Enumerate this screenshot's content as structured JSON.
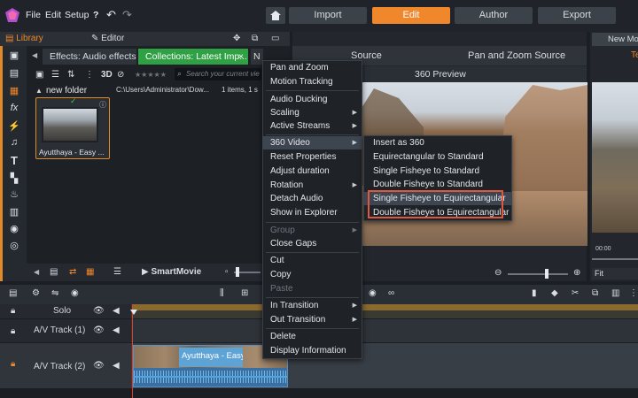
{
  "menubar": {
    "file": "File",
    "edit": "Edit",
    "setup": "Setup",
    "help": "?"
  },
  "top_tabs": [
    "Import",
    "Edit",
    "Author",
    "Export"
  ],
  "left_header": {
    "library": "Library",
    "editor": "Editor"
  },
  "sub_tabs": {
    "effects": "Effects: Audio effects",
    "collections": "Collections: Latest Imp...",
    "more": "N",
    "close": "×"
  },
  "library": {
    "folder": "new folder",
    "path": "C:\\Users\\Administrator\\Dow...",
    "count": "1 items, 1 s",
    "search_placeholder": "Search your current view",
    "tool_3d": "3D",
    "clip_name": "Ayutthaya - Easy ..."
  },
  "bottom_left": {
    "smartmovie": "SmartMovie"
  },
  "preview": {
    "source": "Source",
    "pan_zoom_source": "Pan and Zoom Source",
    "preview_360": "360 Preview",
    "new_mo": "New Mo",
    "fit": "Fit",
    "timecode": "00:00"
  },
  "tracks": [
    {
      "name": "Solo"
    },
    {
      "name": "A/V Track (1)"
    },
    {
      "name": "A/V Track (2)"
    }
  ],
  "timeline_clip": "Ayutthaya - Easy T...",
  "context_menu": {
    "items": [
      {
        "label": "Pan and Zoom",
        "arrow": ""
      },
      {
        "label": "Motion Tracking",
        "arrow": ""
      },
      {
        "label": "Audio Ducking",
        "arrow": ""
      },
      {
        "label": "Scaling",
        "arrow": "▶"
      },
      {
        "label": "Active Streams",
        "arrow": "▶"
      },
      {
        "label": "360 Video",
        "arrow": "▶"
      },
      {
        "label": "Reset Properties",
        "arrow": ""
      },
      {
        "label": "Adjust duration",
        "arrow": ""
      },
      {
        "label": "Rotation",
        "arrow": "▶"
      },
      {
        "label": "Detach Audio",
        "arrow": ""
      },
      {
        "label": "Show in Explorer",
        "arrow": ""
      },
      {
        "label": "Group",
        "arrow": "▶"
      },
      {
        "label": "Close Gaps",
        "arrow": ""
      },
      {
        "label": "Cut",
        "arrow": ""
      },
      {
        "label": "Copy",
        "arrow": ""
      },
      {
        "label": "Paste",
        "arrow": ""
      },
      {
        "label": "In Transition",
        "arrow": "▶"
      },
      {
        "label": "Out Transition",
        "arrow": "▶"
      },
      {
        "label": "Delete",
        "arrow": ""
      },
      {
        "label": "Display Information",
        "arrow": ""
      }
    ]
  },
  "submenu_360": {
    "items": [
      {
        "label": "Insert as 360"
      },
      {
        "label": "Equirectangular to Standard"
      },
      {
        "label": "Single Fisheye to Standard"
      },
      {
        "label": "Double Fisheye to Standard"
      },
      {
        "label": "Single Fisheye to Equirectangular"
      },
      {
        "label": "Double Fisheye to Equirectangular"
      }
    ]
  },
  "colors": {
    "accent": "#f0872a",
    "highlight_box": "#e0573f",
    "collections_tab": "#2fa043",
    "clip": "#3a6fa3"
  }
}
